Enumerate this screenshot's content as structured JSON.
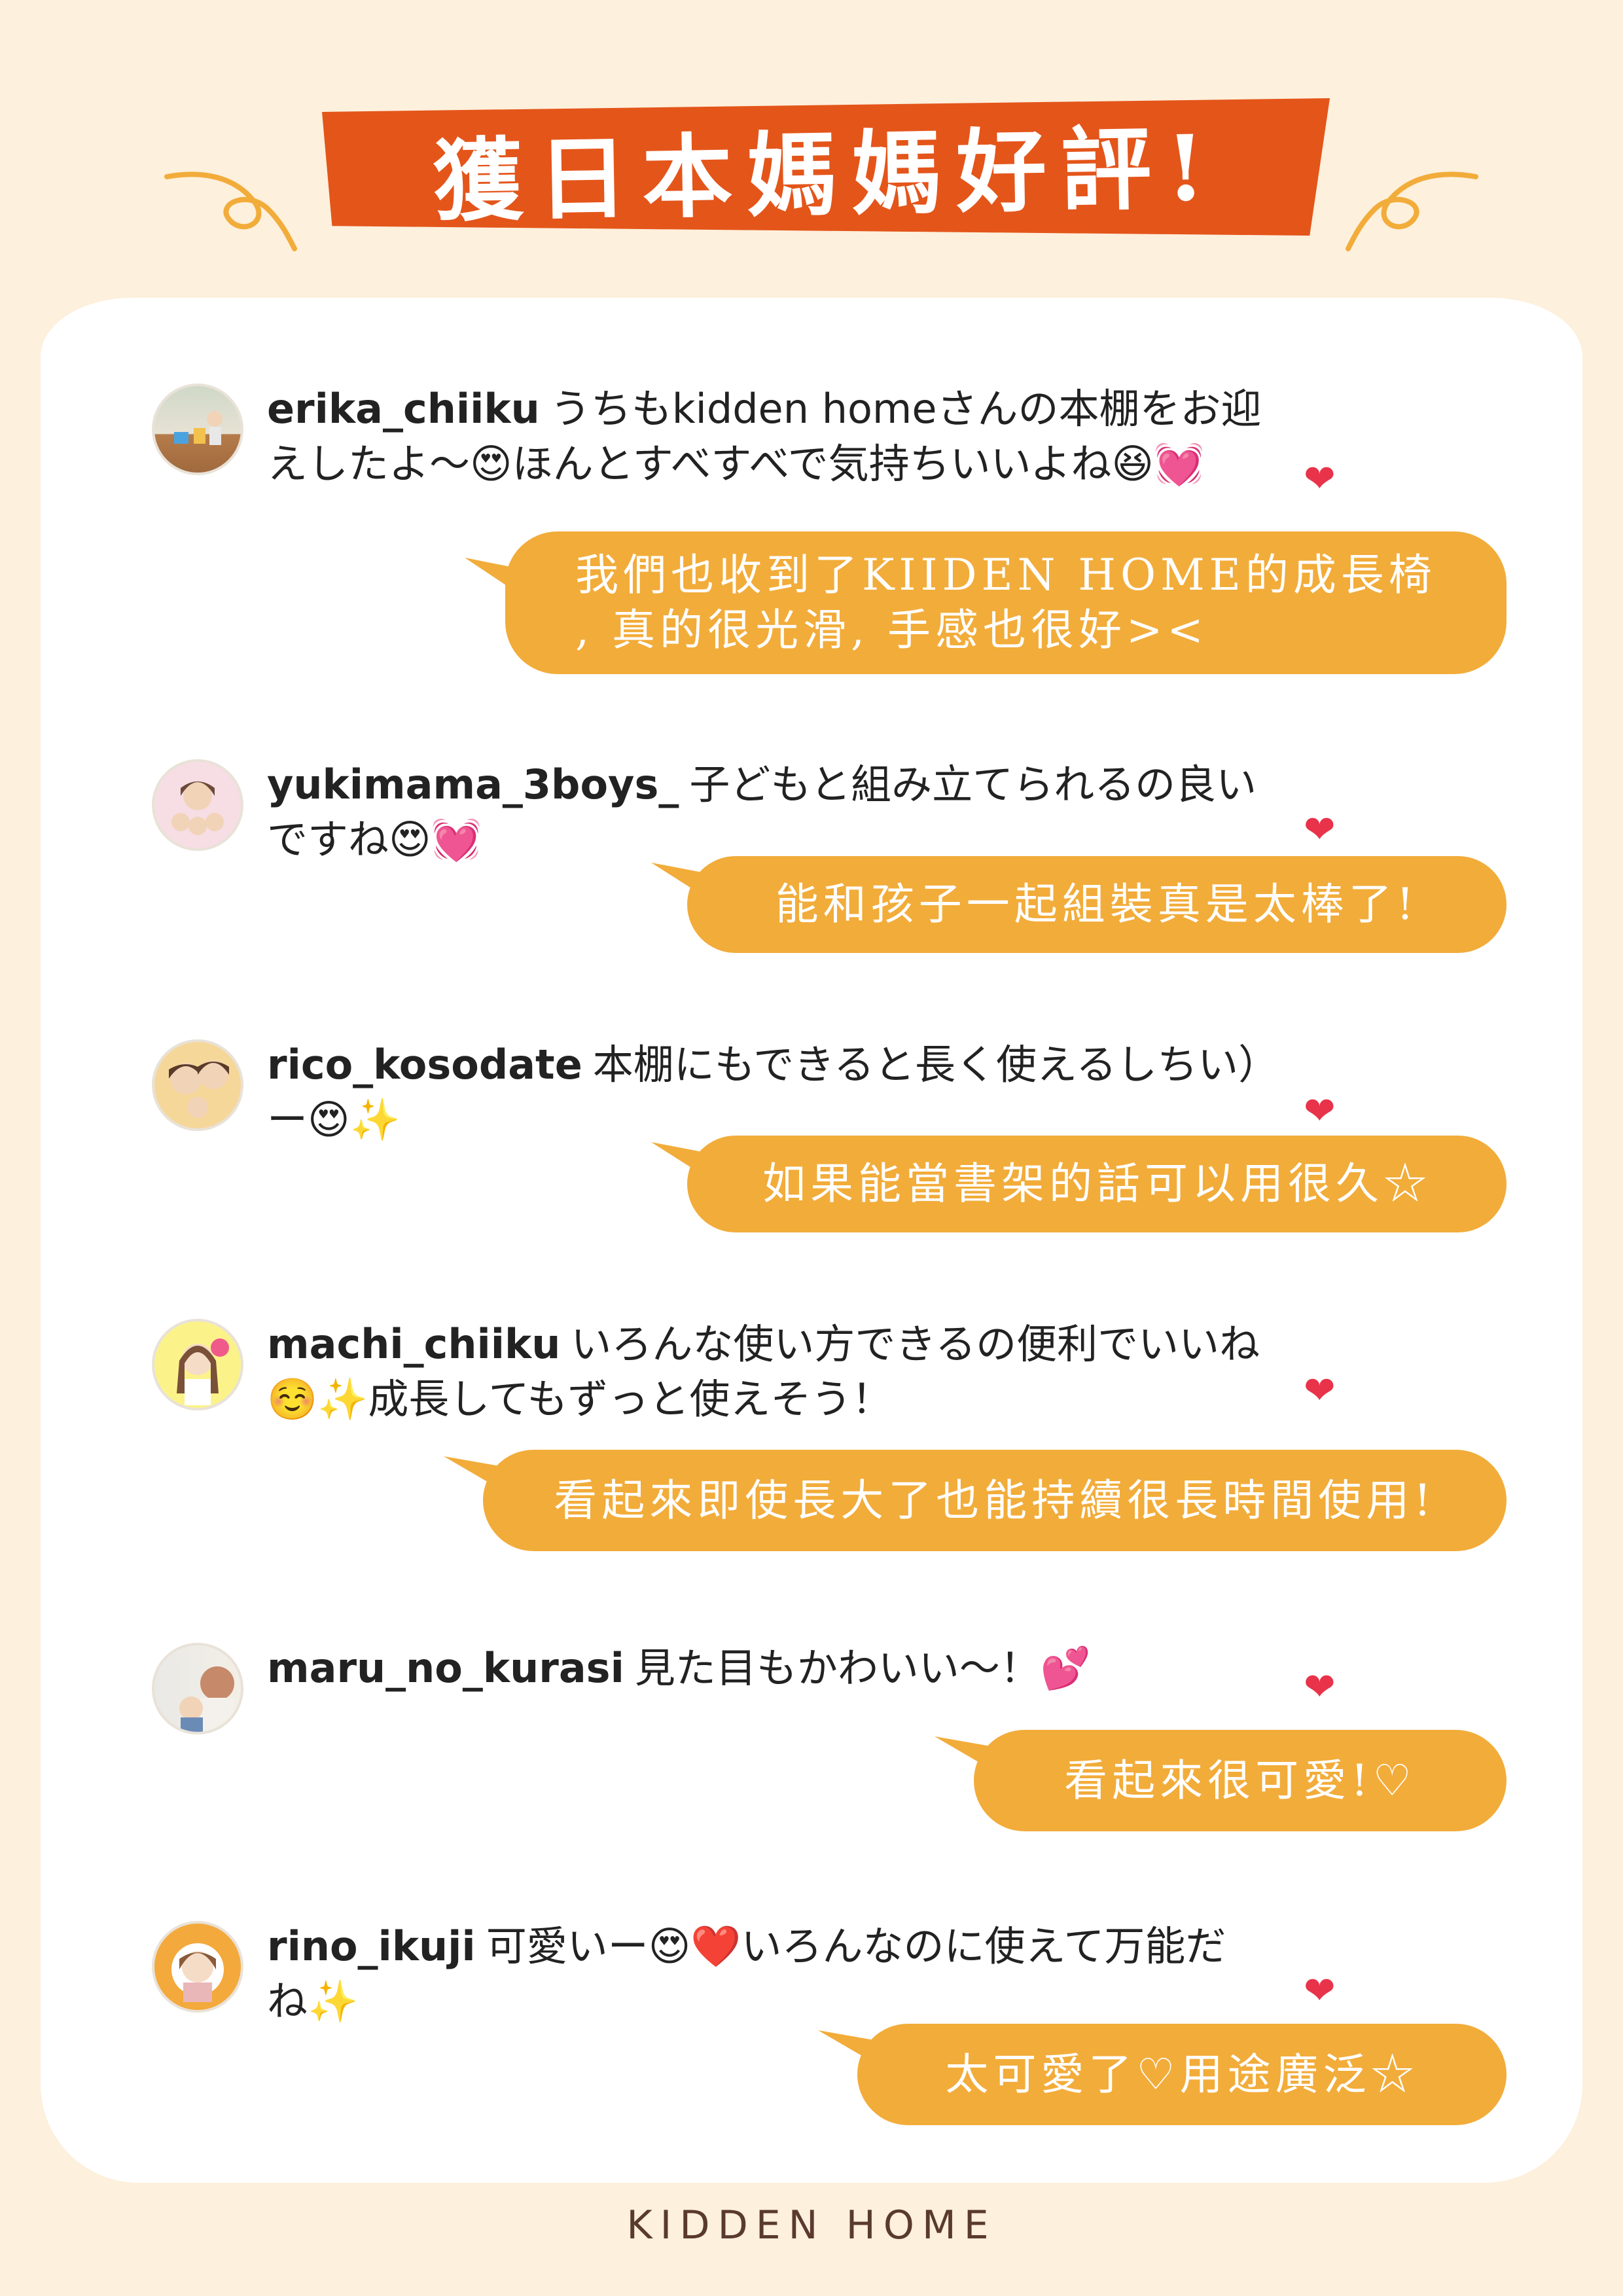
{
  "header": {
    "title": "獲日本媽媽好評!"
  },
  "comments": [
    {
      "user": "erika_chiiku",
      "text": "うちもkidden homeさんの本棚をお迎えしたよ～😍ほんとすべすべで気持ちいいよね😆💓",
      "reply": "我們也收到了KIIDEN HOME的成長椅\n, 真的很光滑, 手感也很好><"
    },
    {
      "user": "yukimama_3boys_",
      "text": "子どもと組み立てられるの良いですね😍💓",
      "reply": "能和孩子一起組裝真是太棒了!"
    },
    {
      "user": "rico_kosodate",
      "text": "本棚にもできると長く使えるしちい）ー😍✨",
      "reply": "如果能當書架的話可以用很久☆"
    },
    {
      "user": "machi_chiiku",
      "text": "いろんな使い方できるの便利でいいね☺️✨成長してもずっと使えそう！",
      "reply": "看起來即使長大了也能持續很長時間使用!"
    },
    {
      "user": "maru_no_kurasi",
      "text": "見た目もかわいい～！💕",
      "reply": "看起來很可愛!♡"
    },
    {
      "user": "rino_ikuji",
      "text": "可愛いー😍❤️いろんなのに使えて万能だね✨",
      "reply": "太可愛了♡用途廣泛☆"
    }
  ],
  "footer": {
    "brand": "KIDDEN HOME"
  },
  "colors": {
    "background": "#fdf0dc",
    "banner": "#e4551a",
    "bubble": "#f2ac3a",
    "heart": "#e8334a"
  }
}
